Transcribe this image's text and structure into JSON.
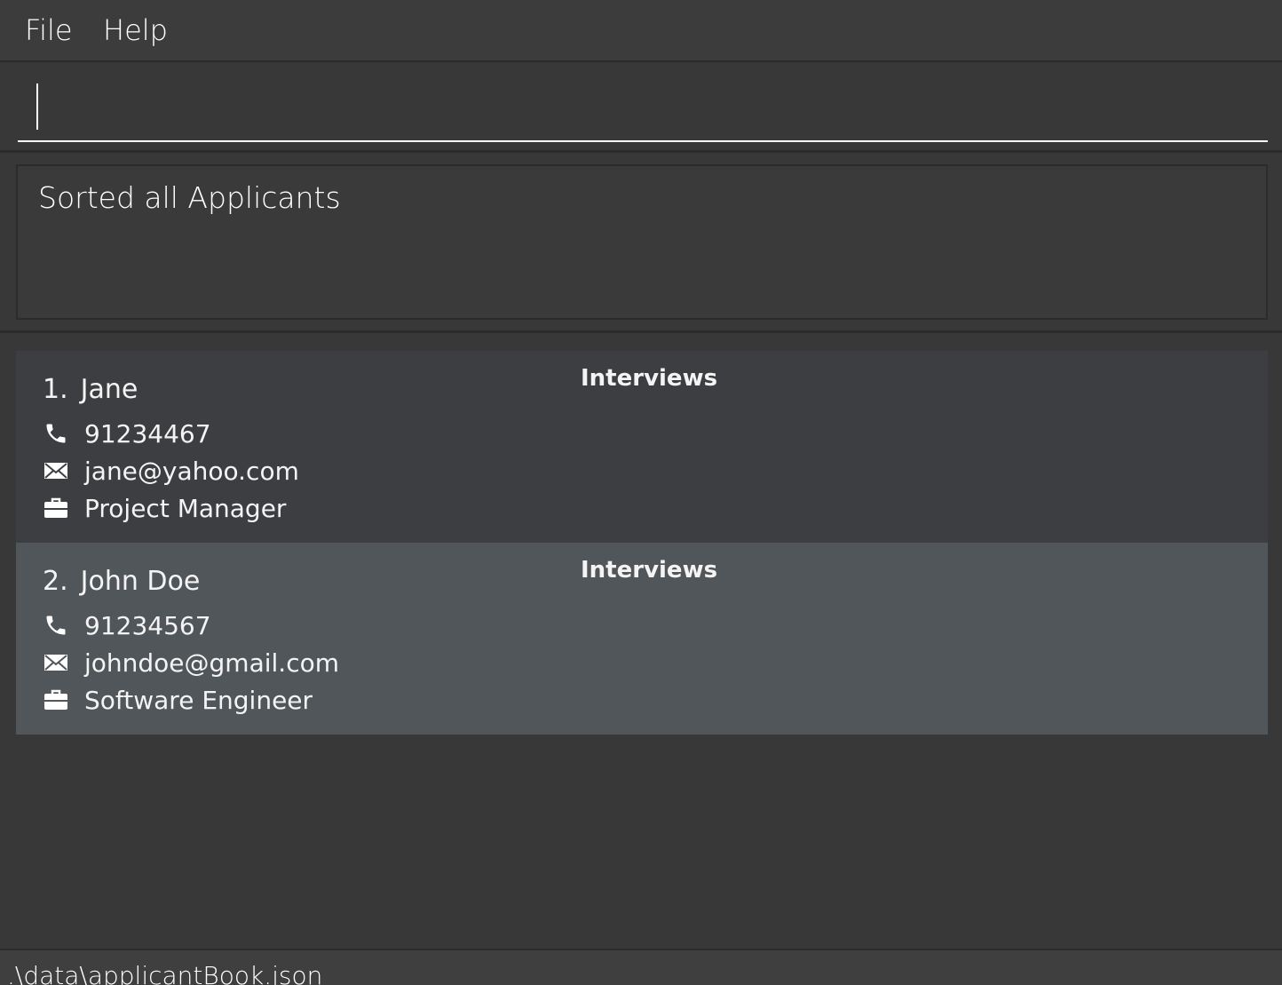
{
  "menu": {
    "file_label": "File",
    "help_label": "Help"
  },
  "command": {
    "value": "",
    "placeholder": ""
  },
  "result": {
    "message": "Sorted all Applicants"
  },
  "applicants": [
    {
      "index": "1.",
      "name": "Jane",
      "phone": "91234467",
      "email": "jane@yahoo.com",
      "job": "Project Manager",
      "interviews_label": "Interviews"
    },
    {
      "index": "2.",
      "name": "John Doe",
      "phone": "91234567",
      "email": "johndoe@gmail.com",
      "job": "Software Engineer",
      "interviews_label": "Interviews"
    }
  ],
  "status": {
    "file_path": ".\\data\\applicantBook.json"
  },
  "colors": {
    "background": "#383838",
    "card_default": "#3c3e41",
    "card_selected": "#51565a",
    "text": "#ffffff"
  },
  "icons": {
    "phone": "phone-icon",
    "email": "envelope-icon",
    "job": "briefcase-icon"
  }
}
